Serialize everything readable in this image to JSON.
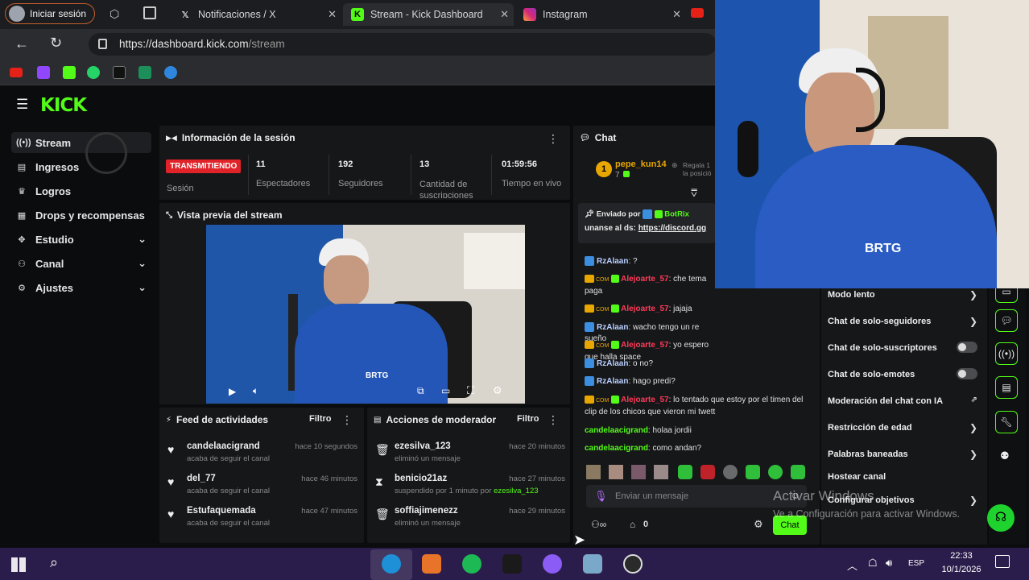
{
  "browser": {
    "signin": "Iniciar sesión",
    "tabs": [
      {
        "label": "Notificaciones / X",
        "icon": "x-icon"
      },
      {
        "label": "Stream - Kick Dashboard",
        "icon": "kick-icon"
      },
      {
        "label": "Instagram",
        "icon": "instagram-icon"
      }
    ],
    "url_host": "https://dashboard.kick.com",
    "url_path": "/stream"
  },
  "kick": {
    "logo": "KICK"
  },
  "sidebar": {
    "items": [
      {
        "label": "Stream",
        "icon": "broadcast-icon"
      },
      {
        "label": "Ingresos",
        "icon": "revenue-icon"
      },
      {
        "label": "Logros",
        "icon": "trophy-icon"
      },
      {
        "label": "Drops y recompensas",
        "icon": "gift-icon"
      },
      {
        "label": "Estudio",
        "icon": "studio-icon"
      },
      {
        "label": "Canal",
        "icon": "channel-icon"
      },
      {
        "label": "Ajustes",
        "icon": "gear-icon"
      }
    ]
  },
  "session": {
    "title": "Información de la sesión",
    "badge": "TRANSMITIENDO",
    "status_label": "Sesión",
    "stats": [
      {
        "value": "11",
        "label": "Espectadores"
      },
      {
        "value": "192",
        "label": "Seguidores"
      },
      {
        "value": "13",
        "label": "Cantidad de suscripciones"
      },
      {
        "value": "01:59:56",
        "label": "Tiempo en vivo"
      }
    ]
  },
  "preview": {
    "title": "Vista previa del stream",
    "shirt": "BRTG"
  },
  "feed": {
    "title": "Feed de actividades",
    "filter": "Filtro",
    "items": [
      {
        "user": "candelaacigrand",
        "sub": "acaba de seguir el canal",
        "time": "hace 10 segundos"
      },
      {
        "user": "del_77",
        "sub": "acaba de seguir el canal",
        "time": "hace 46 minutos"
      },
      {
        "user": "Estufaquemada",
        "sub": "acaba de seguir el canal",
        "time": "hace 47 minutos"
      }
    ]
  },
  "mod": {
    "title": "Acciones de moderador",
    "filter": "Filtro",
    "items": [
      {
        "user": "ezesilva_123",
        "sub": "eliminó un mensaje",
        "time": "hace 20 minutos"
      },
      {
        "user": "benicio21az",
        "sub": "suspendido por 1 minuto por",
        "sub_user": "ezesilva_123",
        "time": "hace 27 minutos"
      },
      {
        "user": "soffiajimenezz",
        "sub": "eliminó un mensaje",
        "time": "hace 29 minutos"
      }
    ]
  },
  "chat": {
    "title": "Chat",
    "top_user": "pepe_kun14",
    "top_rank": "1",
    "top_count": "7",
    "top_hint": "Regala 1",
    "top_hint2": "la posició",
    "pinned_by": "Enviado por",
    "pinned_user": "BotRix",
    "pinned_msg": "unanse al ds:",
    "pinned_link": "https://discord.gg",
    "messages": [
      {
        "user": "RzAlaan",
        "color": "blue",
        "text": "?"
      },
      {
        "user": "Alejoarte_57",
        "color": "red",
        "text": "che tema paga"
      },
      {
        "user": "Alejoarte_57",
        "color": "red",
        "text": "jajaja"
      },
      {
        "user": "RzAlaan",
        "color": "blue",
        "text": "wacho tengo un re sueño"
      },
      {
        "user": "Alejoarte_57",
        "color": "red",
        "text": "yo espero que halla space"
      },
      {
        "user": "RzAlaan",
        "color": "blue",
        "text": "o no?"
      },
      {
        "user": "RzAlaan",
        "color": "blue",
        "text": "hago predi?"
      },
      {
        "user": "Alejoarte_57",
        "color": "red",
        "text": "lo tentado que estoy por el timen del clip de los chicos que vieron mi twett"
      },
      {
        "user": "candelaacigrand",
        "color": "green",
        "text": "holaa jordii"
      },
      {
        "user": "candelaacigrand",
        "color": "green",
        "text": "como andan?"
      }
    ],
    "placeholder": "Enviar un mensaje",
    "points": "0",
    "send": "Chat",
    "sub_badge": "COM"
  },
  "settings": {
    "items": [
      {
        "label": "Modo lento",
        "ctrl": "chevron"
      },
      {
        "label": "Chat de solo-seguidores",
        "ctrl": "chevron"
      },
      {
        "label": "Chat de solo-suscriptores",
        "ctrl": "toggle"
      },
      {
        "label": "Chat de solo-emotes",
        "ctrl": "toggle"
      },
      {
        "label": "Moderación del chat con IA",
        "ctrl": "external"
      },
      {
        "label": "Restricción de edad",
        "ctrl": "chevron"
      },
      {
        "label": "Palabras baneadas",
        "ctrl": "chevron"
      },
      {
        "label": "Hostear canal",
        "ctrl": "none"
      },
      {
        "label": "Configurar objetivos",
        "ctrl": "chevron"
      }
    ]
  },
  "watermark": {
    "line1": "Activar Windows",
    "line2": "Ve a Configuración para activar Windows."
  },
  "webcam": {
    "shirt": "BRTG"
  },
  "taskbar": {
    "time": "22:33",
    "date": "10/1/2026",
    "lang": "ESP"
  },
  "colors": {
    "kick_green": "#53fc18",
    "live_red": "#e02329",
    "taskbar": "#2b1d4b"
  }
}
